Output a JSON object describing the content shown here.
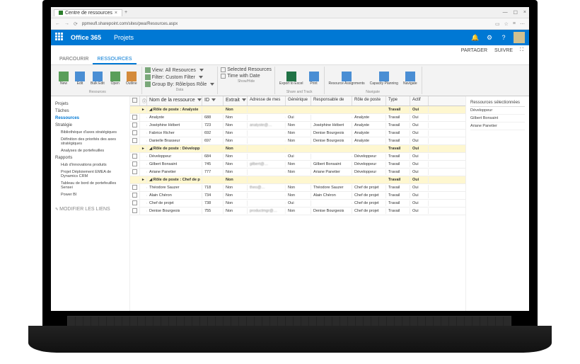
{
  "browser": {
    "tab_title": "Centre de ressources",
    "url": "ppmeufl.sharepoint.com/sites/pwa/Resources.aspx"
  },
  "suite": {
    "brand": "Office 365",
    "app": "Projets"
  },
  "share_row": {
    "partager": "PARTAGER",
    "suivre": "SUIVRE"
  },
  "ribbon_tabs": {
    "parcourir": "PARCOURIR",
    "ressources": "RESSOURCES"
  },
  "ribbon": {
    "new": "New",
    "edit": "Edit",
    "bulk": "Bulk Edit",
    "open": "Open",
    "outline": "Outline",
    "view": "View:",
    "all_resources": "All Resources",
    "filter": "Filter:",
    "custom_filter": "Custom Filter",
    "group_by": "Group By:",
    "rolepos": "Rôle/pos Rôle",
    "selected": "Selected Resources",
    "time_with_date": "Time with Date",
    "export_excel": "Export to Excel",
    "print": "Print",
    "resource_assign": "Resource Assignments",
    "capacity": "Capacity Planning",
    "navigate": "Navigate",
    "grp_resources": "Resources",
    "grp_data": "Data",
    "grp_showhide": "Show/Hide",
    "grp_share": "Share and Track",
    "grp_navigate": "Navigate"
  },
  "leftnav": {
    "projets": "Projets",
    "taches": "Tâches",
    "ressources": "Ressources",
    "strategie": "Stratégie",
    "bibliotheque": "Bibliothèque d'axes stratégiques",
    "definition": "Définition des priorités des axes stratégiques",
    "analyses": "Analyses de portefeuilles",
    "rapports": "Rapports",
    "hub": "Hub d'innovations produits",
    "projet_emea": "Projet Déploiement EMEA de Dynamics CRM",
    "tableau": "Tableau de bord de portefeuilles Sensei",
    "powerbi": "Power BI",
    "edit": "MODIFIER LES LIENS"
  },
  "columns": {
    "name": "Nom de la ressource",
    "id": "ID",
    "ext": "Extrait",
    "email": "Adresse de mes",
    "generic": "Générique",
    "resp": "Responsable de",
    "role": "Rôle de poste",
    "type": "Type",
    "actif": "Actif"
  },
  "groups": [
    {
      "label": "Rôle de poste : Analyste",
      "ext": "Non",
      "type": "Travail",
      "actif": "Oui"
    },
    {
      "label": "Rôle de poste : Développ",
      "ext": "Non",
      "type": "Travail",
      "actif": "Oui"
    },
    {
      "label": "Rôle de poste : Chef de p",
      "ext": "Non",
      "type": "Travail",
      "actif": "Oui"
    }
  ],
  "rows": [
    {
      "g": 0,
      "name": "Analyste",
      "id": "688",
      "ext": "Non",
      "email": "",
      "gen": "Oui",
      "resp": "",
      "role": "Analyste",
      "type": "Travail",
      "actif": "Oui"
    },
    {
      "g": 0,
      "name": "Joséphine Hébert",
      "id": "723",
      "ext": "Non",
      "email": "analyste@…",
      "gen": "Non",
      "resp": "Joséphine Hébert",
      "role": "Analyste",
      "type": "Travail",
      "actif": "Oui"
    },
    {
      "g": 0,
      "name": "Fabrice Richer",
      "id": "692",
      "ext": "Non",
      "email": "",
      "gen": "Non",
      "resp": "Denise Bourgeois",
      "role": "Analyste",
      "type": "Travail",
      "actif": "Oui"
    },
    {
      "g": 0,
      "name": "Danielle Brasseur",
      "id": "697",
      "ext": "Non",
      "email": "",
      "gen": "Non",
      "resp": "Denise Bourgeois",
      "role": "Analyste",
      "type": "Travail",
      "actif": "Oui"
    },
    {
      "g": 1,
      "name": "Développeur",
      "id": "684",
      "ext": "Non",
      "email": "",
      "gen": "Oui",
      "resp": "",
      "role": "Développeur",
      "type": "Travail",
      "actif": "Oui"
    },
    {
      "g": 1,
      "name": "Gilbert Bonsaint",
      "id": "745",
      "ext": "Non",
      "email": "gilbert@…",
      "gen": "Non",
      "resp": "Gilbert Bonsaint",
      "role": "Développeur",
      "type": "Travail",
      "actif": "Oui"
    },
    {
      "g": 1,
      "name": "Ariane Panetier",
      "id": "777",
      "ext": "Non",
      "email": "",
      "gen": "Non",
      "resp": "Ariane Panetier",
      "role": "Développeur",
      "type": "Travail",
      "actif": "Oui"
    },
    {
      "g": 2,
      "name": "Théodore Sauzer",
      "id": "718",
      "ext": "Non",
      "email": "theo@…",
      "gen": "Non",
      "resp": "Théodore Sauzer",
      "role": "Chef de projet",
      "type": "Travail",
      "actif": "Oui"
    },
    {
      "g": 2,
      "name": "Alain Chéron",
      "id": "734",
      "ext": "Non",
      "email": "",
      "gen": "Non",
      "resp": "Alain Chéron",
      "role": "Chef de projet",
      "type": "Travail",
      "actif": "Oui"
    },
    {
      "g": 2,
      "name": "Chef de projet",
      "id": "738",
      "ext": "Non",
      "email": "",
      "gen": "Oui",
      "resp": "",
      "role": "Chef de projet",
      "type": "Travail",
      "actif": "Oui"
    },
    {
      "g": 2,
      "name": "Denise Bourgeois",
      "id": "755",
      "ext": "Non",
      "email": "productmgr@…",
      "gen": "Non",
      "resp": "Denise Bourgeois",
      "role": "Chef de projet",
      "type": "Travail",
      "actif": "Oui"
    }
  ],
  "rightpanel": {
    "title": "Ressources sélectionnées",
    "items": [
      "Développeur",
      "Gilbert Bonsaint",
      "Ariane Panetier"
    ]
  }
}
